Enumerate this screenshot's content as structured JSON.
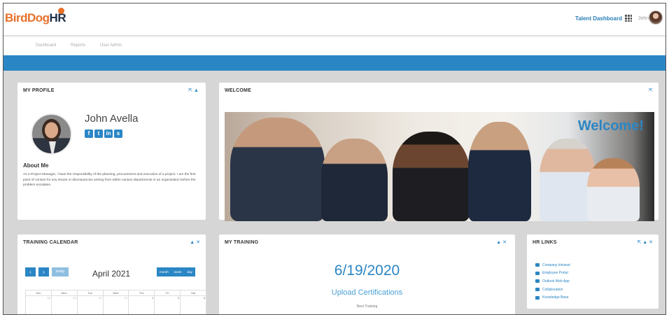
{
  "header": {
    "logo": {
      "part1": "Bird",
      "part2": "Dog",
      "part3": "HR"
    },
    "dashboard_label": "Talent Dashboard",
    "user_name": "John"
  },
  "nav": [
    "Dashboard",
    "Reports",
    "User Admin"
  ],
  "profile": {
    "title": "My Profile",
    "name": "John Avella",
    "about_heading": "About Me",
    "about_text": "As a Project Manager, I have the responsibility of the planning, procurement and execution of a project. I am the first point of contact for any issues or discrepancies arising from within various departments in an organization before the problem escalates.",
    "controls": "⇱ ▲"
  },
  "welcome": {
    "title": "Welcome",
    "banner_text": "Welcome!",
    "controls": "⇱"
  },
  "calendar": {
    "title": "Training Calendar",
    "controls": "▲ ✕",
    "prev": "‹",
    "next": "›",
    "today": "today",
    "month_title": "April 2021",
    "views": [
      "month",
      "week",
      "day"
    ],
    "weekdays": [
      "Sun",
      "Mon",
      "Tue",
      "Wed",
      "Thu",
      "Fri",
      "Sat"
    ],
    "days": [
      "28",
      "29",
      "30",
      "31",
      "1",
      "2",
      "3"
    ]
  },
  "training": {
    "title": "My Training",
    "controls": "▲ ✕",
    "date": "6/19/2020",
    "course": "Upload Certifications",
    "next_label": "Next Training"
  },
  "hr_links": {
    "title": "HR Links",
    "controls": "⇱ ▲ ✕",
    "items": [
      "Company Intranet",
      "Employee Portal",
      "Outlook Web App",
      "Collaboration",
      "Knowledge Base"
    ]
  },
  "colors": {
    "accent": "#2b86c5",
    "brand_orange": "#e8702a"
  }
}
